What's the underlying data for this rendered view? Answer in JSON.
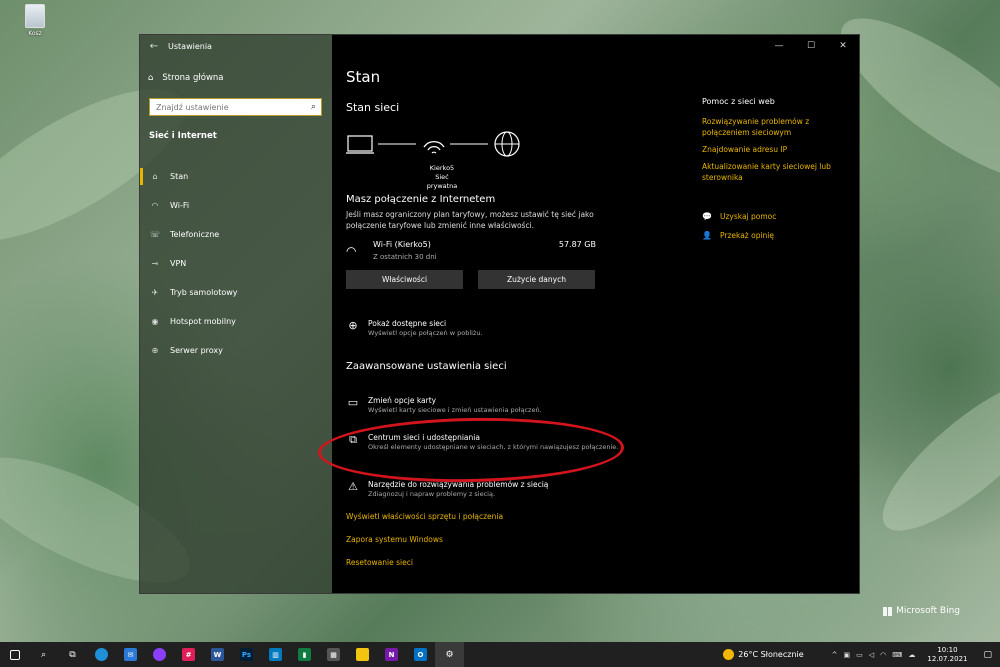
{
  "desktop": {
    "recycle_bin_label": "Kosz"
  },
  "window": {
    "title": "Ustawienia",
    "controls": {
      "minimize": "—",
      "maximize": "☐",
      "close": "✕"
    }
  },
  "sidebar": {
    "home_label": "Strona główna",
    "search_placeholder": "Znajdź ustawienie",
    "section_title": "Sieć i Internet",
    "items": [
      {
        "label": "Stan",
        "icon": "home-icon",
        "active": true
      },
      {
        "label": "Wi-Fi",
        "icon": "wifi-icon"
      },
      {
        "label": "Telefoniczne",
        "icon": "dialup-icon"
      },
      {
        "label": "VPN",
        "icon": "vpn-icon"
      },
      {
        "label": "Tryb samolotowy",
        "icon": "airplane-icon"
      },
      {
        "label": "Hotspot mobilny",
        "icon": "hotspot-icon"
      },
      {
        "label": "Serwer proxy",
        "icon": "proxy-icon"
      }
    ]
  },
  "main": {
    "title": "Stan",
    "network_status_title": "Stan sieci",
    "diagram": {
      "network_name": "Kierko5",
      "network_type": "Sieć prywatna"
    },
    "connection": {
      "title": "Masz połączenie z Internetem",
      "description": "Jeśli masz ograniczony plan taryfowy, możesz ustawić tę sieć jako połączenie taryfowe lub zmienić inne właściwości.",
      "wifi_name": "Wi-Fi (Kierko5)",
      "wifi_period": "Z ostatnich 30 dni",
      "usage": "57.87 GB",
      "properties_button": "Właściwości",
      "usage_button": "Zużycie danych"
    },
    "show_networks": {
      "title": "Pokaż dostępne sieci",
      "description": "Wyświetl opcje połączeń w pobliżu."
    },
    "advanced_title": "Zaawansowane ustawienia sieci",
    "change_adapter": {
      "title": "Zmień opcje karty",
      "description": "Wyświetl karty sieciowe i zmień ustawienia połączeń."
    },
    "sharing_center": {
      "title": "Centrum sieci i udostępniania",
      "description": "Określ elementy udostępniane w sieciach, z którymi nawiązujesz połączenie."
    },
    "troubleshooter": {
      "title": "Narzędzie do rozwiązywania problemów z siecią",
      "description": "Zdiagnozuj i napraw problemy z siecią."
    },
    "links": [
      "Wyświetl właściwości sprzętu i połączenia",
      "Zapora systemu Windows",
      "Resetowanie sieci"
    ]
  },
  "help": {
    "title": "Pomoc z sieci web",
    "links": [
      "Rozwiązywanie problemów z połączeniem sieciowym",
      "Znajdowanie adresu IP",
      "Aktualizowanie karty sieciowej lub sterownika"
    ],
    "get_help": "Uzyskaj pomoc",
    "feedback": "Przekaż opinię"
  },
  "watermark": "Microsoft Bing",
  "taskbar": {
    "weather": "26°C  Słonecznie",
    "time": "10:10",
    "date": "12.07.2021"
  },
  "colors": {
    "accent": "#e8b500",
    "annotation": "#d2141c",
    "taskbar": "#202020"
  }
}
